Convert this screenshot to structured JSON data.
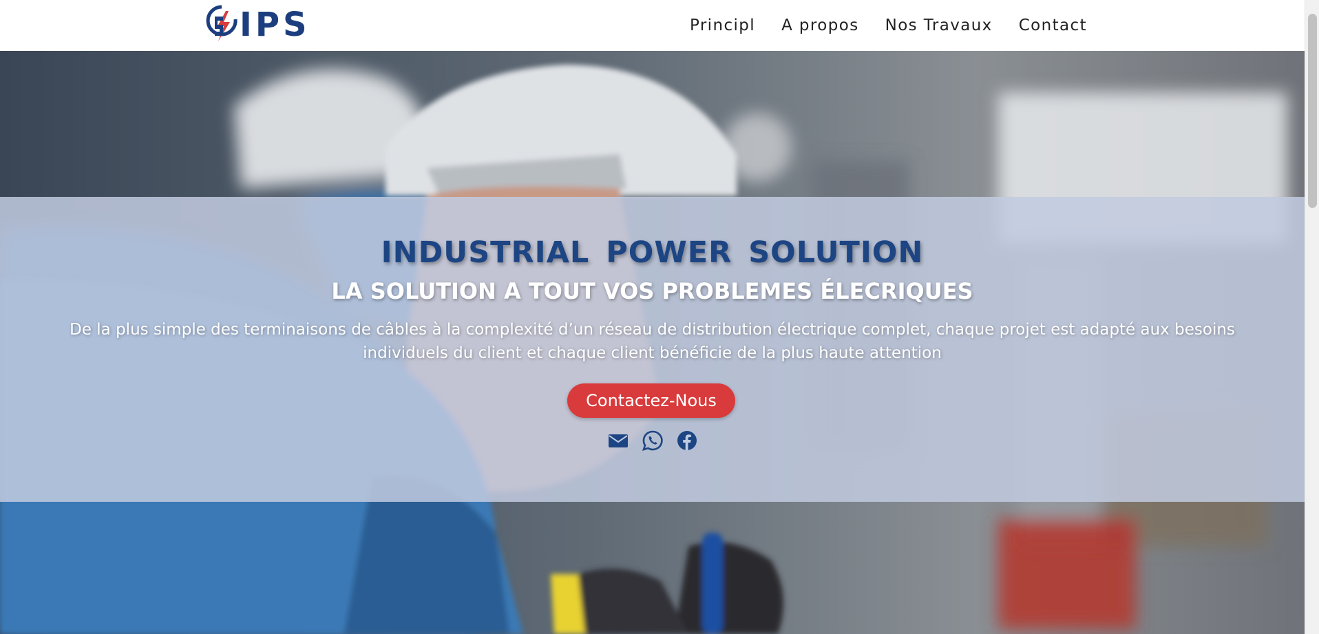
{
  "brand": {
    "logo_text": "IPS",
    "primary_color": "#1d3e7e",
    "accent_color": "#d93a3b"
  },
  "nav": {
    "items": [
      {
        "label": "Principl"
      },
      {
        "label": "A propos"
      },
      {
        "label": "Nos Travaux"
      },
      {
        "label": "Contact"
      }
    ]
  },
  "hero": {
    "title": "INDUSTRIAL  POWER  SOLUTION",
    "subtitle": "LA SOLUTION A TOUT VOS PROBLEMES ÉLECRIQUES",
    "description": "De la plus simple des terminaisons de câbles à la complexité d’un réseau de distribution électrique complet, chaque projet est adapté aux besoins individuels du client et chaque client bénéficie de la plus haute attention",
    "cta_label": "Contactez-Nous",
    "social": [
      {
        "icon": "envelope-icon"
      },
      {
        "icon": "whatsapp-icon"
      },
      {
        "icon": "facebook-icon"
      }
    ]
  }
}
